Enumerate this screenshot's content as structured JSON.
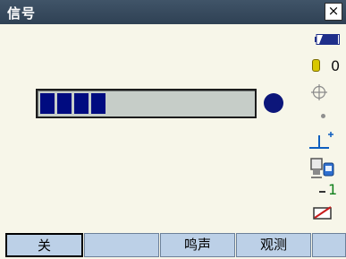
{
  "window": {
    "title": "信号",
    "close_label": "×"
  },
  "signal": {
    "level_fraction": 0.4
  },
  "status": {
    "battery": "battery-icon",
    "tilt_value": "0",
    "mode_number": "1",
    "colors": {
      "battery": "#1f2f8a",
      "prism": "#0f5fbf",
      "number": "#0f7f1a",
      "bubble": "#d8c800"
    }
  },
  "softkeys": {
    "f1": "关",
    "f2": "",
    "f3": "鸣声",
    "f4": "观测",
    "f5": ""
  },
  "colors": {
    "titlebar": "#3c4f63",
    "background": "#f7f6e9",
    "progress_fill": "#000b80",
    "button": "#bcd0e7"
  }
}
